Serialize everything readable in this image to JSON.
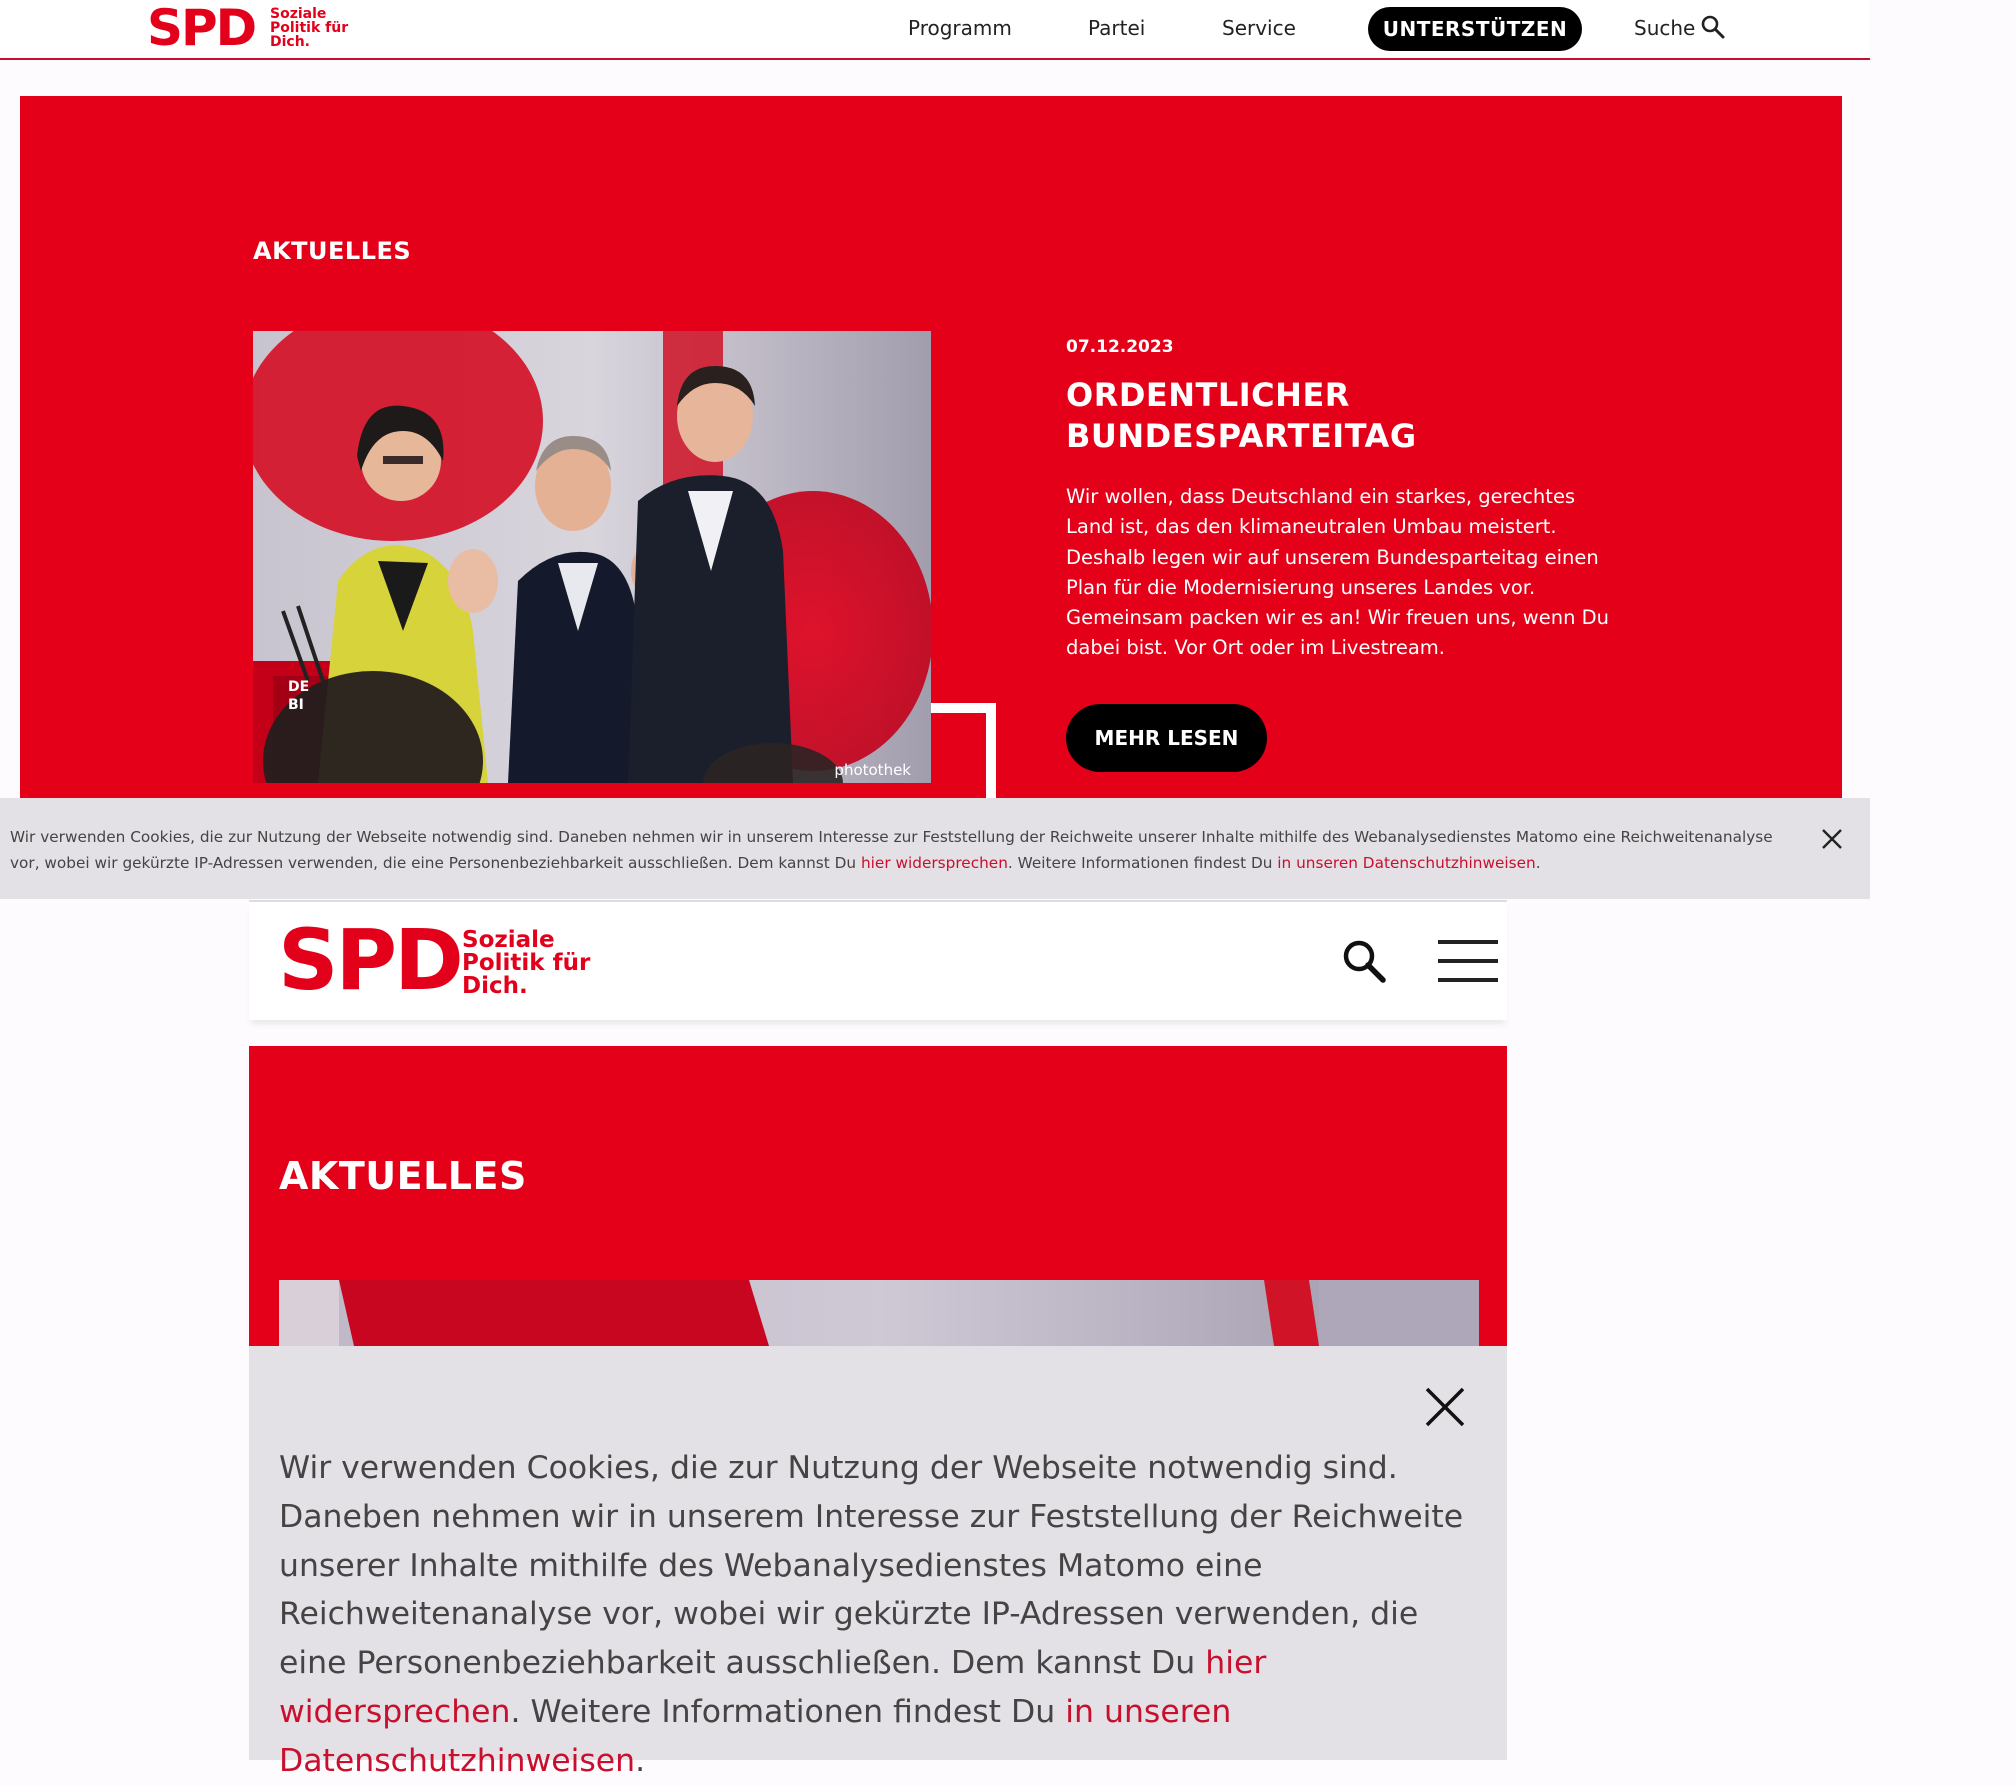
{
  "brand": {
    "logo_word": "SPD",
    "slogan_line1": "Soziale",
    "slogan_line2": "Politik für",
    "slogan_line3": "Dich.",
    "color_red": "#e30018",
    "color_black": "#000000"
  },
  "desktop": {
    "nav": {
      "items": [
        {
          "label": "Programm"
        },
        {
          "label": "Partei"
        },
        {
          "label": "Service"
        }
      ],
      "support_label": "UNTERSTÜTZEN",
      "search_label": "Suche"
    },
    "hero": {
      "section_title": "AKTUELLES",
      "photo_credit": "photothek",
      "date": "07.12.2023",
      "title": "ORDENTLICHER BUNDESPARTEITAG",
      "text": "Wir wollen, dass Deutschland ein starkes, gerechtes Land ist, das den klimaneutralen Umbau meistert. Deshalb legen wir auf unserem Bundesparteitag einen Plan für die Modernisierung unseres Landes vor. Gemeinsam packen wir es an! Wir freuen uns, wenn Du dabei bist. Vor Ort oder im Livestream.",
      "more_label": "MEHR LESEN"
    },
    "cookie": {
      "text_before": "Wir verwenden Cookies, die zur Nutzung der Webseite notwendig sind. Daneben nehmen wir in unserem Interesse zur Feststellung der Reichweite unserer Inhalte mithilfe des Webanalysedienstes Matomo eine Reichweitenanalyse vor, wobei wir gekürzte IP-Adressen verwenden, die eine Personenbeziehbarkeit ausschließen. Dem kannst Du ",
      "link_object": "hier widersprechen",
      "text_middle": ". Weitere Informationen findest Du ",
      "link_privacy": "in unseren Datenschutzhinweisen",
      "text_after": "."
    }
  },
  "mobile": {
    "section_title": "AKTUELLES",
    "cookie": {
      "text_before": "Wir verwenden Cookies, die zur Nutzung der Webseite notwendig sind. Daneben nehmen wir in unserem Interesse zur Feststellung der Reichweite unserer Inhalte mithilfe des Webanalysedienstes Matomo eine Reichweitenanalyse vor, wobei wir gekürzte IP-Adressen verwenden, die eine Personenbeziehbarkeit ausschließen. Dem kannst Du ",
      "link_object": "hier widersprechen",
      "text_middle": ". Weitere Informationen findest Du ",
      "link_privacy": "in unseren Datenschutzhinweisen",
      "text_after": "."
    }
  },
  "icons": {
    "search": "search-icon",
    "close": "close-icon",
    "menu": "hamburger-menu-icon"
  }
}
